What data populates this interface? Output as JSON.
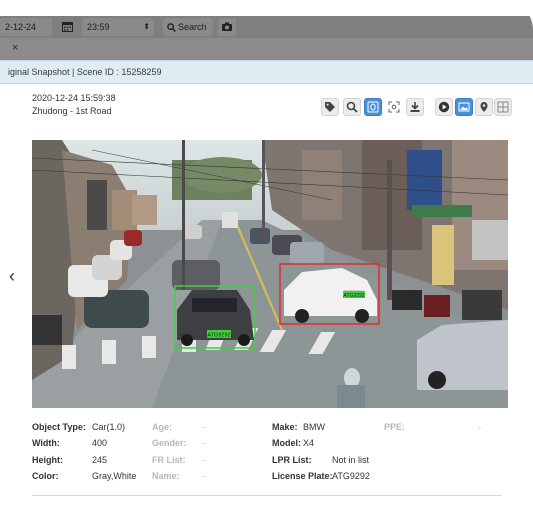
{
  "toolbar": {
    "date_value": "2-12-24",
    "time_value": "23:59",
    "search_label": "Search"
  },
  "window": {
    "close_glyph": "×",
    "title": "iginal Snapshot | Scene ID : 15258259"
  },
  "snapshot": {
    "timestamp": "2020-12-24 15:59:38",
    "location": "Zhudong - 1st Road"
  },
  "actions": [
    {
      "name": "tag-icon"
    },
    {
      "name": "search-icon"
    },
    {
      "name": "face-icon",
      "active": true
    },
    {
      "name": "focus-icon"
    },
    {
      "name": "download-icon"
    },
    {
      "name": "play-icon"
    },
    {
      "name": "image-icon",
      "active": true
    },
    {
      "name": "location-pin-icon"
    },
    {
      "name": "grid-icon"
    }
  ],
  "scene": {
    "green_box_label": "ATG9292",
    "red_box_label": "ATG9292",
    "green_color": "#3fcf3f",
    "red_color": "#e52a2a"
  },
  "details": {
    "object_type": {
      "label": "Object Type:",
      "value": "Car(1.0)"
    },
    "width": {
      "label": "Width:",
      "value": "400"
    },
    "height": {
      "label": "Height:",
      "value": "245"
    },
    "color": {
      "label": "Color:",
      "value": "Gray,White"
    },
    "age": {
      "label": "Age:",
      "value": "-"
    },
    "gender": {
      "label": "Gender:",
      "value": "-"
    },
    "fr_list": {
      "label": "FR List:",
      "value": "-"
    },
    "name": {
      "label": "Name:",
      "value": "-"
    },
    "make": {
      "label": "Make:",
      "value": "BMW"
    },
    "model": {
      "label": "Model:",
      "value": "X4"
    },
    "lpr_list": {
      "label": "LPR List:",
      "value": "Not in list"
    },
    "license_plate": {
      "label": "License Plate:",
      "value": "ATG9292"
    },
    "ppe": {
      "label": "PPE:",
      "value": "-"
    }
  }
}
